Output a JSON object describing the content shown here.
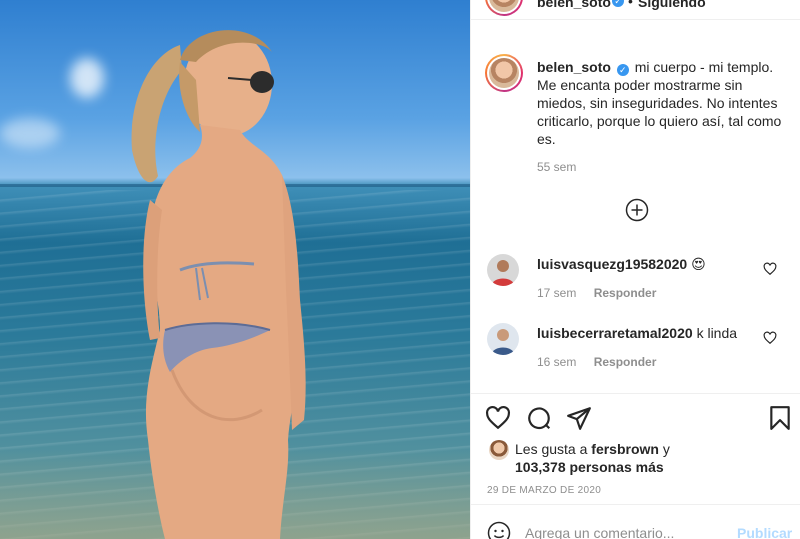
{
  "post": {
    "photo_alt": "",
    "author": {
      "username": "belen_soto",
      "verified": true,
      "follow_status": "Siguiendo",
      "separator": "•"
    },
    "caption": {
      "username": "belen_soto",
      "text": "mi cuerpo - mi templo. Me encanta poder mostrarme sin miedos, sin inseguridades. No intentes criticarlo, porque lo quiero así, tal como es.",
      "time": "55 sem"
    },
    "comments": [
      {
        "username": "luisvasquezg19582020",
        "text": "😍",
        "time": "17 sem",
        "reply_label": "Responder"
      },
      {
        "username": "luisbecerraretamal2020",
        "text": "k linda",
        "time": "16 sem",
        "reply_label": "Responder"
      }
    ],
    "likes": {
      "prefix": "Les gusta a",
      "user": "fersbrown",
      "conjunction": "y",
      "count": "103,378",
      "suffix": "personas más"
    },
    "date": "29 DE MARZO DE 2020",
    "add_comment": {
      "placeholder": "Agrega un comentario...",
      "publish_label": "Publicar"
    }
  },
  "colors": {
    "link": "#3897f0",
    "muted": "#8e8e8e",
    "publish_disabled": "#b3dbff",
    "border": "#efefef"
  },
  "icons": [
    "verified-badge-icon",
    "more-comments-plus-icon",
    "heart-icon",
    "comment-icon",
    "share-icon",
    "save-bookmark-icon",
    "emoji-icon"
  ]
}
